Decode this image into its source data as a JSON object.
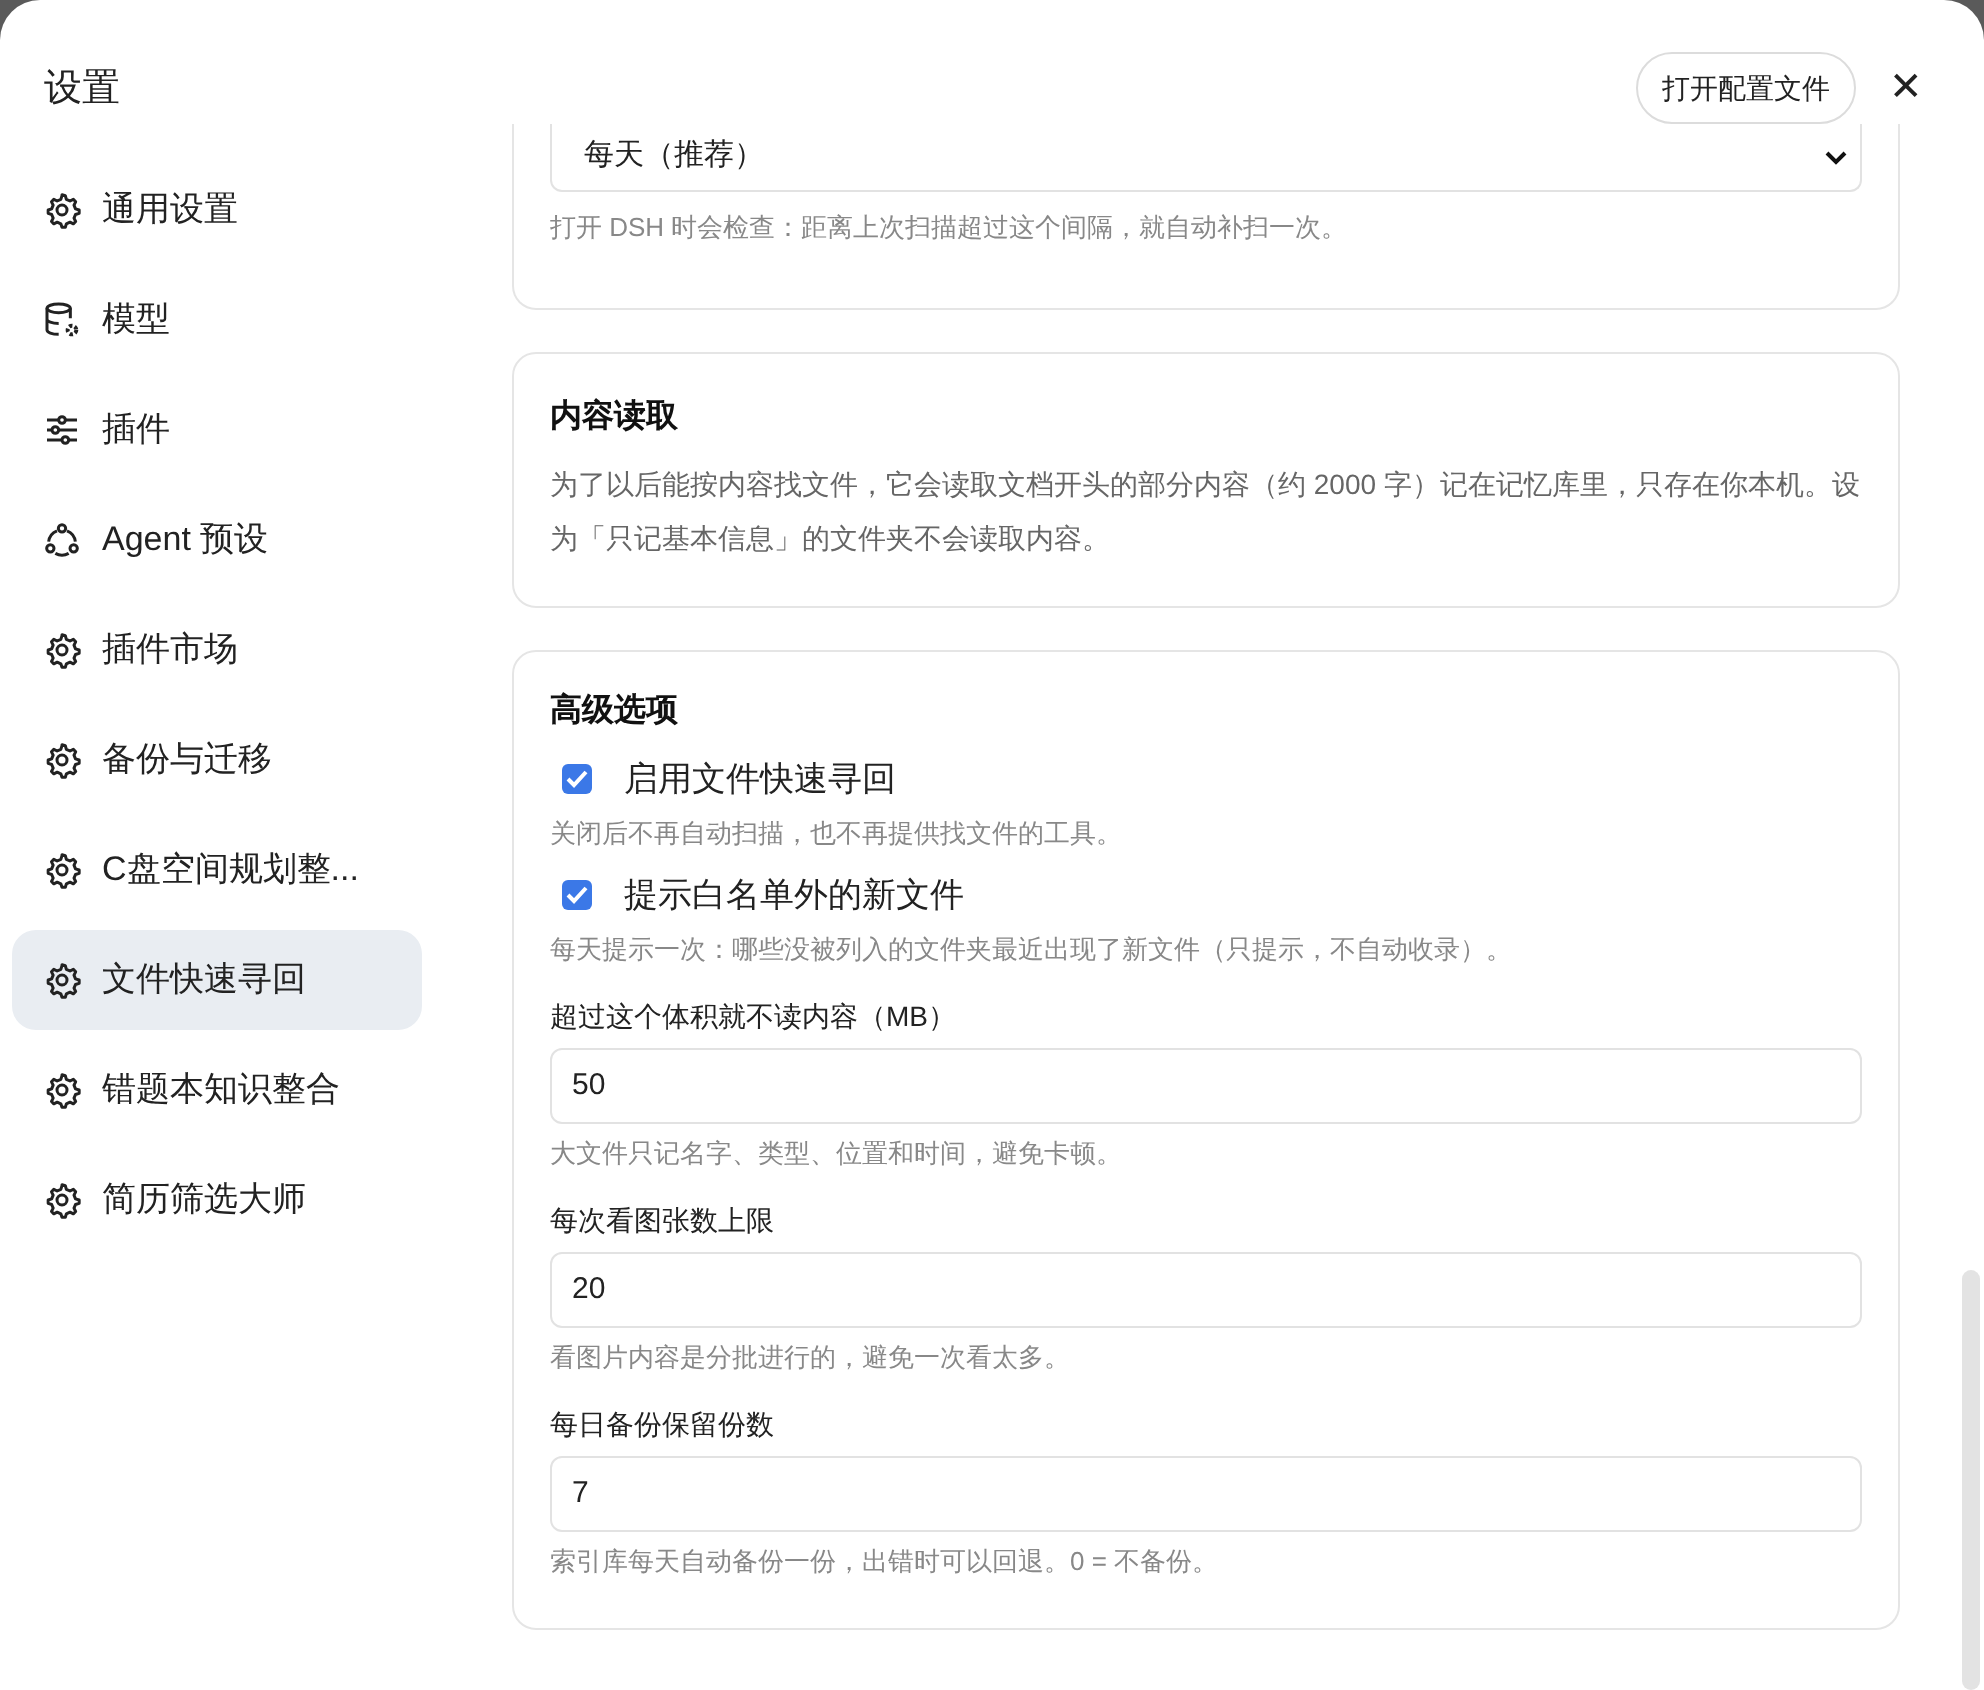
{
  "window": {
    "title": "设置"
  },
  "header": {
    "open_config_button": "打开配置文件",
    "close_button": "✕"
  },
  "sidebar": {
    "items": [
      {
        "label": "通用设置",
        "kind": "gear",
        "selected": false
      },
      {
        "label": "模型",
        "kind": "database",
        "selected": false
      },
      {
        "label": "插件",
        "kind": "sliders",
        "selected": false
      },
      {
        "label": "Agent 预设",
        "kind": "agent",
        "selected": false
      },
      {
        "label": "插件市场",
        "kind": "gear",
        "selected": false
      },
      {
        "label": "备份与迁移",
        "kind": "gear",
        "selected": false
      },
      {
        "label": "C盘空间规划整...",
        "kind": "gear",
        "selected": false
      },
      {
        "label": "文件快速寻回",
        "kind": "gear",
        "selected": true
      },
      {
        "label": "错题本知识整合",
        "kind": "gear",
        "selected": false
      },
      {
        "label": "简历筛选大师",
        "kind": "gear",
        "selected": false
      }
    ]
  },
  "scan_card": {
    "select_value": "每天（推荐）",
    "help": "打开 DSH 时会检查：距离上次扫描超过这个间隔，就自动补扫一次。"
  },
  "content_card": {
    "title": "内容读取",
    "description": "为了以后能按内容找文件，它会读取文档开头的部分内容（约 2000 字）记在记忆库里，只存在你本机。设为「只记基本信息」的文件夹不会读取内容。"
  },
  "advanced_card": {
    "title": "高级选项",
    "settings": [
      {
        "kind": "checkbox",
        "label": "启用文件快速寻回",
        "checked": true,
        "help": "关闭后不再自动扫描，也不再提供找文件的工具。"
      },
      {
        "kind": "checkbox",
        "label": "提示白名单外的新文件",
        "checked": true,
        "help": "每天提示一次：哪些没被列入的文件夹最近出现了新文件（只提示，不自动收录）。"
      },
      {
        "kind": "number",
        "label": "超过这个体积就不读内容（MB）",
        "value": "50",
        "help": "大文件只记名字、类型、位置和时间，避免卡顿。"
      },
      {
        "kind": "number",
        "label": "每次看图张数上限",
        "value": "20",
        "help": "看图片内容是分批进行的，避免一次看太多。"
      },
      {
        "kind": "number",
        "label": "每日备份保留份数",
        "value": "7",
        "help": "索引库每天自动备份一份，出错时可以回退。0 = 不备份。"
      }
    ]
  }
}
